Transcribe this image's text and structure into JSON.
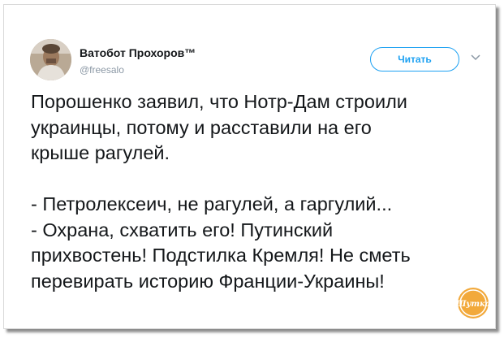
{
  "tweet": {
    "author": {
      "display_name": "Ватобот Прохоров™",
      "handle": "@freesalo"
    },
    "follow_button_label": "Читать",
    "menu_icon": "chevron-down-icon",
    "lines": [
      "Порошенко заявил, что Нотр-Дам строили",
      "украинцы, потому и расставили на его",
      "крыше рагулей.",
      "",
      "- Петролексеич, не рагулей, а гаргулий...",
      "- Охрана, схватить его! Путинский",
      "прихвостень! Подстилка Кремля! Не сметь",
      "перевирать историю Франции-Украины!"
    ]
  },
  "watermark": {
    "text": "Шутка",
    "icon": "site-logo-badge"
  },
  "colors": {
    "accent": "#1da1f2",
    "text": "#14171a",
    "secondary_text": "#8b98a5",
    "watermark": "#f2a93b"
  }
}
